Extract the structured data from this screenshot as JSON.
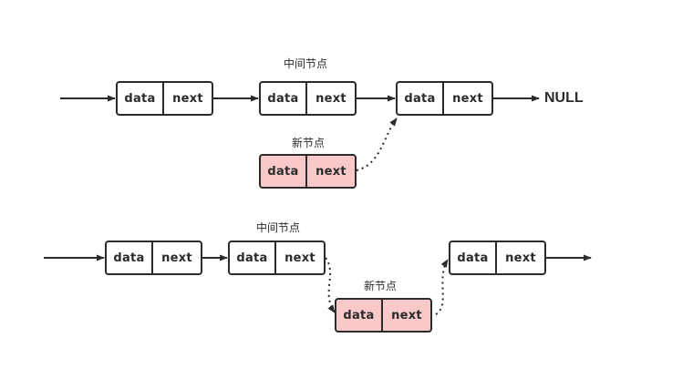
{
  "top": {
    "label_middle": "中间节点",
    "label_new": "新节点",
    "null_label": "NULL",
    "nodes": [
      {
        "data": "data",
        "next": "next"
      },
      {
        "data": "data",
        "next": "next"
      },
      {
        "data": "data",
        "next": "next"
      },
      {
        "data": "data",
        "next": "next"
      }
    ]
  },
  "bottom": {
    "label_middle": "中间节点",
    "label_new": "新节点",
    "nodes": [
      {
        "data": "data",
        "next": "next"
      },
      {
        "data": "data",
        "next": "next"
      },
      {
        "data": "data",
        "next": "next"
      },
      {
        "data": "data",
        "next": "next"
      }
    ]
  },
  "colors": {
    "new_node_fill": "#f9c9c9",
    "stroke": "#2b2b2b"
  }
}
